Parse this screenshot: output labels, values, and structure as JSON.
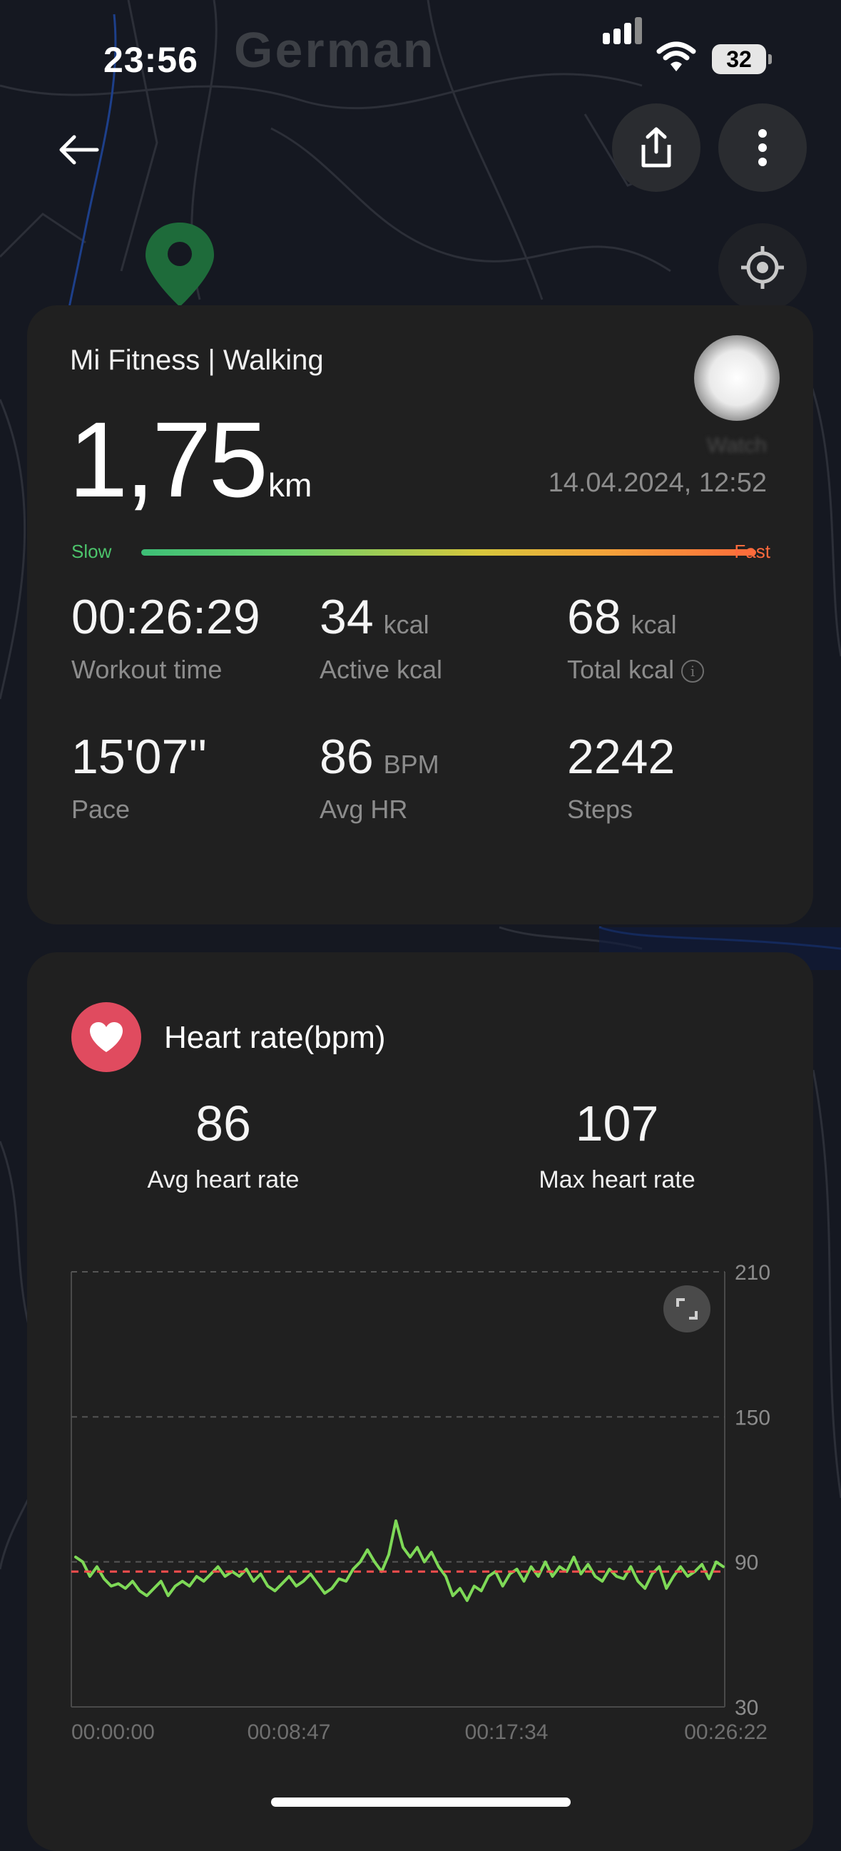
{
  "status_bar": {
    "time": "23:56",
    "battery": "32"
  },
  "map": {
    "label": "German"
  },
  "summary": {
    "app_title": "Mi Fitness | Walking",
    "distance_value": "1,75",
    "distance_unit": "km",
    "datetime": "14.04.2024, 12:52",
    "device_name": "Watch",
    "speed_slow": "Slow",
    "speed_fast": "Fast",
    "stats": [
      {
        "value": "00:26:29",
        "unit": "",
        "label": "Workout time"
      },
      {
        "value": "34",
        "unit": "kcal",
        "label": "Active kcal"
      },
      {
        "value": "68",
        "unit": "kcal",
        "label": "Total kcal"
      },
      {
        "value": "15'07''",
        "unit": "",
        "label": "Pace"
      },
      {
        "value": "86",
        "unit": "BPM",
        "label": "Avg HR"
      },
      {
        "value": "2242",
        "unit": "",
        "label": "Steps"
      }
    ]
  },
  "heart_rate": {
    "title": "Heart rate(bpm)",
    "avg_value": "86",
    "avg_label": "Avg heart rate",
    "max_value": "107",
    "max_label": "Max heart rate"
  },
  "colors": {
    "background": "#151821",
    "card": "#202020",
    "heart_icon_bg": "#e04b5f",
    "hr_line": "#7ed957",
    "avg_line": "#ff4d4d",
    "text_secondary": "#8c8c8c"
  },
  "icons": {
    "back": "arrow-left-icon",
    "share": "share-icon",
    "more": "more-vertical-icon",
    "locate": "crosshair-icon",
    "heart": "heart-icon",
    "expand": "expand-icon",
    "info": "info-icon"
  },
  "chart_data": {
    "type": "line",
    "y_ticks": [
      "210",
      "150",
      "90",
      "30"
    ],
    "ylim": [
      30,
      210
    ],
    "x_ticks": [
      "00:00:00",
      "00:08:47",
      "00:17:34",
      "00:26:22"
    ],
    "xlim": [
      0,
      26.37
    ],
    "grid": true,
    "avg_line": 86,
    "series": [
      {
        "values": [
          92,
          90,
          84,
          88,
          83,
          80,
          81,
          79,
          82,
          78,
          76,
          79,
          82,
          76,
          80,
          82,
          80,
          84,
          82,
          85,
          88,
          84,
          86,
          84,
          87,
          82,
          85,
          80,
          78,
          81,
          84,
          80,
          82,
          85,
          81,
          77,
          79,
          83,
          82,
          87,
          90,
          95,
          90,
          86,
          93,
          107,
          96,
          92,
          96,
          90,
          94,
          88,
          84,
          76,
          79,
          74,
          80,
          78,
          84,
          86,
          80,
          85,
          87,
          82,
          88,
          84,
          90,
          84,
          88,
          86,
          92,
          85,
          89,
          84,
          82,
          87,
          84,
          83,
          88,
          82,
          79,
          85,
          88,
          79,
          84,
          88,
          84,
          86,
          89,
          83,
          90,
          88
        ]
      }
    ]
  }
}
